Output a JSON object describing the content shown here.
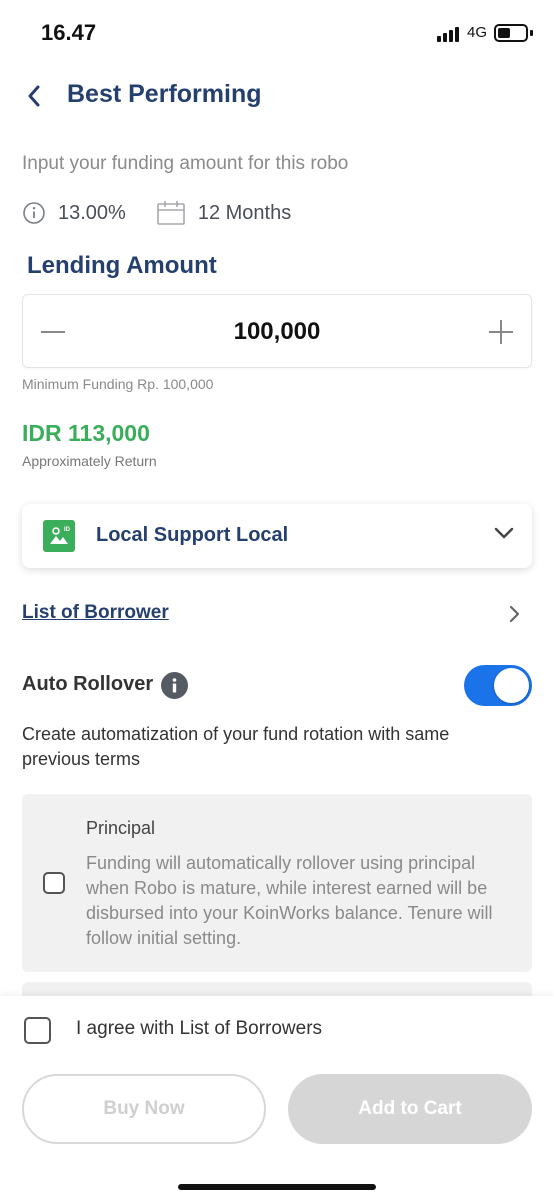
{
  "status_bar": {
    "time": "16.47",
    "network": "4G"
  },
  "header": {
    "title": "Best Performing"
  },
  "subtitle": "Input your funding amount for this robo",
  "meta": {
    "rate": "13.00%",
    "tenure": "12 Months"
  },
  "lending": {
    "title": "Lending Amount",
    "value": "100,000",
    "min_note": "Minimum Funding Rp. 100,000"
  },
  "return": {
    "amount": "IDR 113,000",
    "label": "Approximately Return"
  },
  "robo": {
    "selected": "Local Support Local",
    "icon_badge": "ID"
  },
  "borrower_link": "List of Borrower",
  "rollover": {
    "label": "Auto Rollover",
    "enabled": true,
    "description": "Create automatization of your fund rotation with same previous terms"
  },
  "option_principal": {
    "title": "Principal",
    "description": "Funding will automatically rollover using principal when Robo is mature, while interest earned will be disbursed into your KoinWorks balance. Tenure will follow initial setting."
  },
  "agreement": {
    "label": "I agree with List of Borrowers"
  },
  "buttons": {
    "buy": "Buy Now",
    "cart": "Add to Cart"
  },
  "colors": {
    "primary_navy": "#25406e",
    "accent_green": "#3aae5a",
    "toggle_blue": "#1a73e8"
  }
}
